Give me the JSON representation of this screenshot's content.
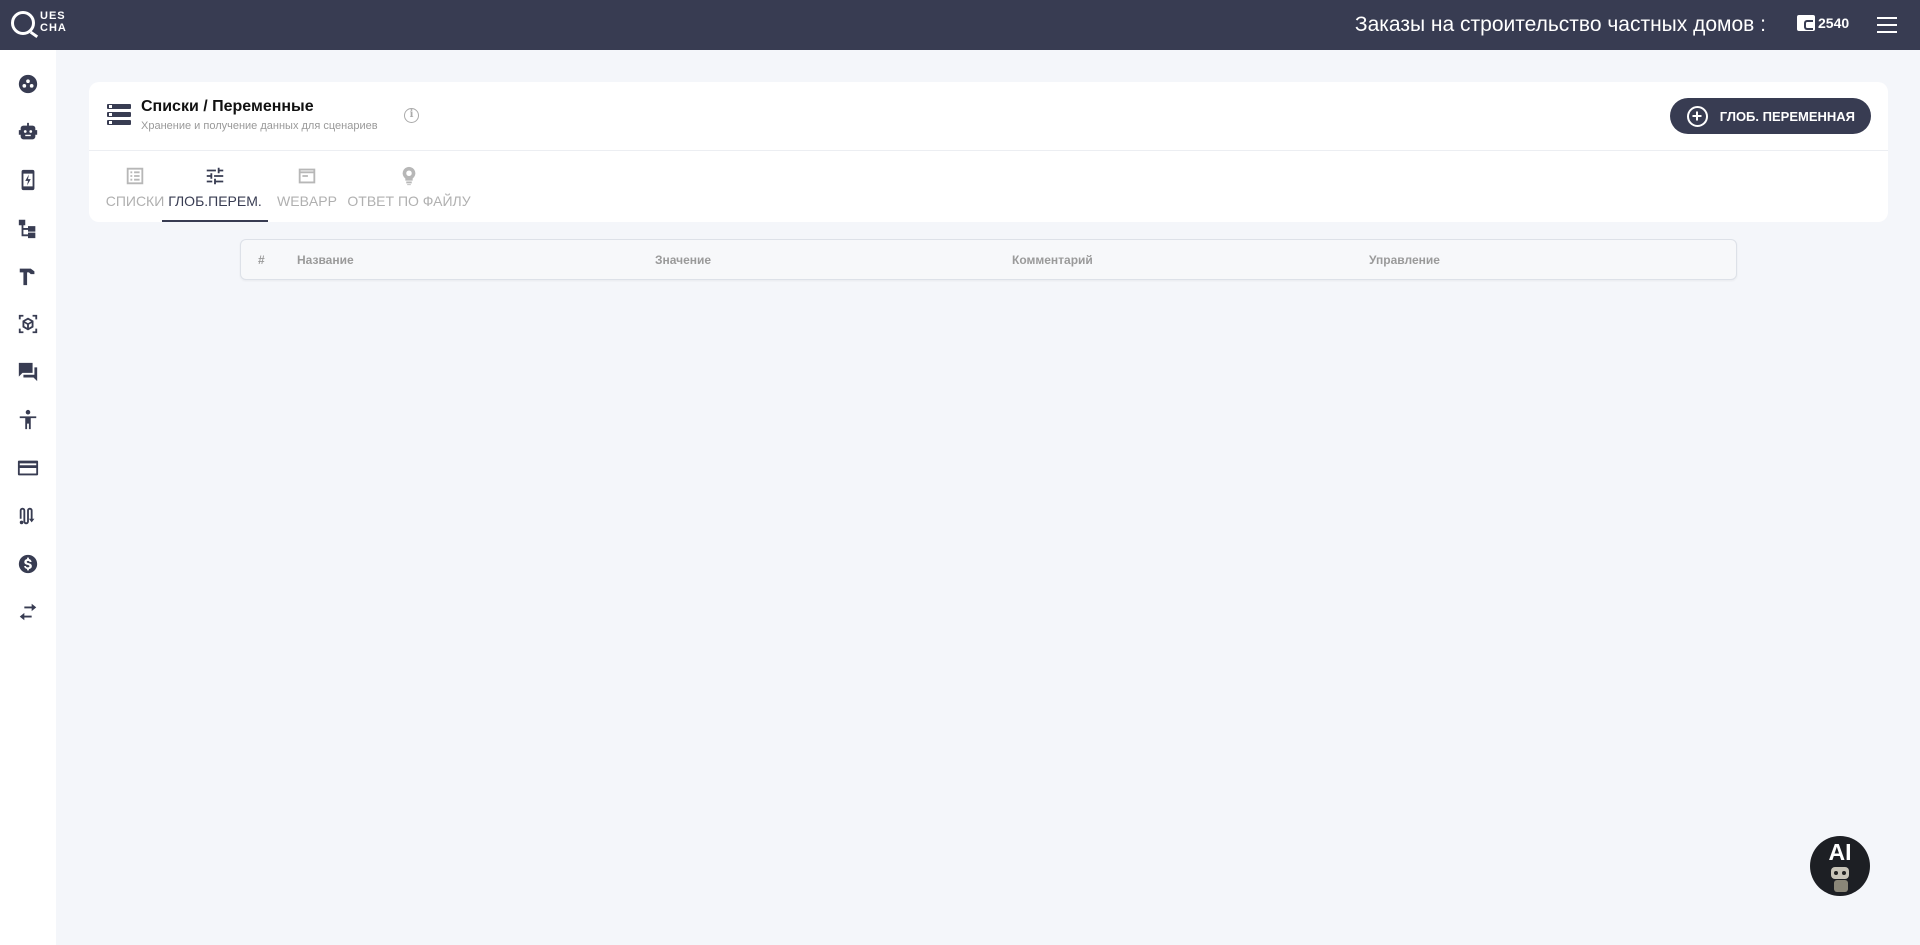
{
  "app": {
    "logo_line1": "UES",
    "logo_line2": "CHA",
    "project_title": "Заказы на строительство частных домов :",
    "balance": "2540"
  },
  "sidebar": {
    "items": [
      {
        "name": "sidebar-item-dashboard",
        "icon": "dots-circle-icon"
      },
      {
        "name": "sidebar-item-bots",
        "icon": "robot-icon"
      },
      {
        "name": "sidebar-item-devices",
        "icon": "phone-bolt-icon"
      },
      {
        "name": "sidebar-item-structure",
        "icon": "hierarchy-icon"
      },
      {
        "name": "sidebar-item-tools",
        "icon": "hammer-icon"
      },
      {
        "name": "sidebar-item-ar",
        "icon": "cube-scan-icon"
      },
      {
        "name": "sidebar-item-chats",
        "icon": "chat-bubbles-icon"
      },
      {
        "name": "sidebar-item-accessibility",
        "icon": "person-icon"
      },
      {
        "name": "sidebar-item-payments",
        "icon": "credit-card-icon"
      },
      {
        "name": "sidebar-item-routes",
        "icon": "route-icon"
      },
      {
        "name": "sidebar-item-billing",
        "icon": "dollar-circle-icon"
      },
      {
        "name": "sidebar-item-exchange",
        "icon": "swap-arrows-icon"
      }
    ]
  },
  "panel": {
    "title": "Списки / Переменные",
    "subtitle": "Хранение и получение данных для сценариев",
    "add_button_label": "ГЛОБ. ПЕРЕМЕННАЯ",
    "tabs": [
      {
        "label": "СПИСКИ",
        "icon": "list-icon",
        "active": false
      },
      {
        "label": "ГЛОБ.ПЕРЕМ.",
        "icon": "sliders-icon",
        "active": true
      },
      {
        "label": "WEBAPP",
        "icon": "browser-window-icon",
        "active": false
      },
      {
        "label": "ОТВЕТ ПО ФАЙЛУ",
        "icon": "file-lightbulb-icon",
        "active": false
      }
    ]
  },
  "table": {
    "columns": [
      "#",
      "Название",
      "Значение",
      "Комментарий",
      "Управление"
    ],
    "rows": []
  },
  "ai_button": {
    "label": "AI"
  }
}
